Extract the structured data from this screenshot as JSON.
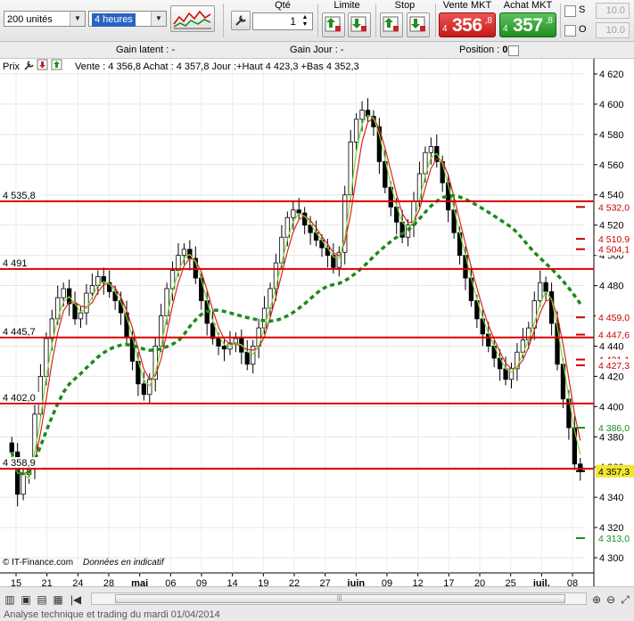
{
  "toolbar": {
    "units_select": "200 unités",
    "period_select": "4 heures",
    "qty_label": "Qté",
    "qty_value": "1",
    "limit_label": "Limite",
    "stop_label": "Stop",
    "sell": {
      "label": "Vente MKT",
      "prefix": "4",
      "price": "356",
      "decimal": ",8"
    },
    "buy": {
      "label": "Achat MKT",
      "prefix": "4",
      "price": "357",
      "decimal": ",8"
    },
    "check_s": "S",
    "check_o": "O",
    "field_s": "10.0",
    "field_o": "10.0"
  },
  "infobar": {
    "gain_latent": "Gain latent : -",
    "gain_jour": "Gain Jour : -",
    "position_label": "Position : ",
    "position_value": "0"
  },
  "chart": {
    "legend_prefix": "Prix",
    "legend_text": "Vente : 4 356,8 Achat : 4 357,8 Jour :+Haut 4 423,3 +Bas 4 352,3",
    "copyright": "© IT-Finance.com",
    "disclaimer": "Données en indicatif"
  },
  "chart_data": {
    "type": "candlestick",
    "timeframe": "4 heures",
    "y_range": [
      4290,
      4630
    ],
    "y_ticks": [
      "4 620",
      "4 600",
      "4 580",
      "4 560",
      "4 540",
      "4 520",
      "4 500",
      "4 480",
      "4 460",
      "4 440",
      "4 420",
      "4 400",
      "4 380",
      "4 360",
      "4 340",
      "4 320",
      "4 300"
    ],
    "x_labels": [
      "15",
      "21",
      "24",
      "28",
      "mai",
      "06",
      "09",
      "14",
      "19",
      "22",
      "27",
      "juin",
      "09",
      "12",
      "17",
      "20",
      "25",
      "juil.",
      "08"
    ],
    "horizontal_levels": [
      {
        "label": "4 535,8",
        "value": 4535.8
      },
      {
        "label": "4 491",
        "value": 4491
      },
      {
        "label": "4 445,7",
        "value": 4445.7
      },
      {
        "label": "4 402,0",
        "value": 4402
      },
      {
        "label": "4 358,9",
        "value": 4358.9
      }
    ],
    "right_markers": [
      {
        "label": "4 532,0",
        "value": 4532,
        "color": "#cc0000"
      },
      {
        "label": "4 510,9",
        "value": 4510.9,
        "color": "#cc0000"
      },
      {
        "label": "4 504,1",
        "value": 4504.1,
        "color": "#cc0000"
      },
      {
        "label": "4 459,0",
        "value": 4459,
        "color": "#cc0000"
      },
      {
        "label": "4 447,6",
        "value": 4447.6,
        "color": "#cc0000"
      },
      {
        "label": "4 431,1",
        "value": 4431.1,
        "color": "#cc0000"
      },
      {
        "label": "4 427,3",
        "value": 4427.3,
        "color": "#cc0000"
      },
      {
        "label": "4 386,0",
        "value": 4386,
        "color": "#1a8a1a"
      },
      {
        "label": "4 357,3",
        "value": 4357.3,
        "color": "#000000",
        "highlight": "#f2e630"
      },
      {
        "label": "4 313,0",
        "value": 4313,
        "color": "#1a8a1a"
      }
    ],
    "close_series": [
      4370,
      4342,
      4355,
      4360,
      4395,
      4420,
      4445,
      4458,
      4472,
      4478,
      4468,
      4458,
      4462,
      4475,
      4480,
      4486,
      4482,
      4476,
      4470,
      4462,
      4446,
      4430,
      4415,
      4408,
      4418,
      4440,
      4460,
      4478,
      4490,
      4500,
      4504,
      4498,
      4485,
      4470,
      4455,
      4445,
      4440,
      4438,
      4442,
      4445,
      4436,
      4428,
      4440,
      4452,
      4465,
      4478,
      4495,
      4512,
      4525,
      4530,
      4528,
      4520,
      4515,
      4510,
      4505,
      4500,
      4492,
      4502,
      4540,
      4575,
      4590,
      4596,
      4592,
      4585,
      4562,
      4545,
      4532,
      4522,
      4512,
      4520,
      4536,
      4554,
      4568,
      4572,
      4562,
      4548,
      4530,
      4515,
      4500,
      4485,
      4470,
      4458,
      4448,
      4440,
      4432,
      4425,
      4418,
      4425,
      4436,
      4444,
      4452,
      4470,
      4482,
      4476,
      4455,
      4428,
      4405,
      4386,
      4362,
      4357
    ]
  },
  "bottom": {
    "status_text": "Analyse technique et trading du mardi 01/04/2014"
  }
}
